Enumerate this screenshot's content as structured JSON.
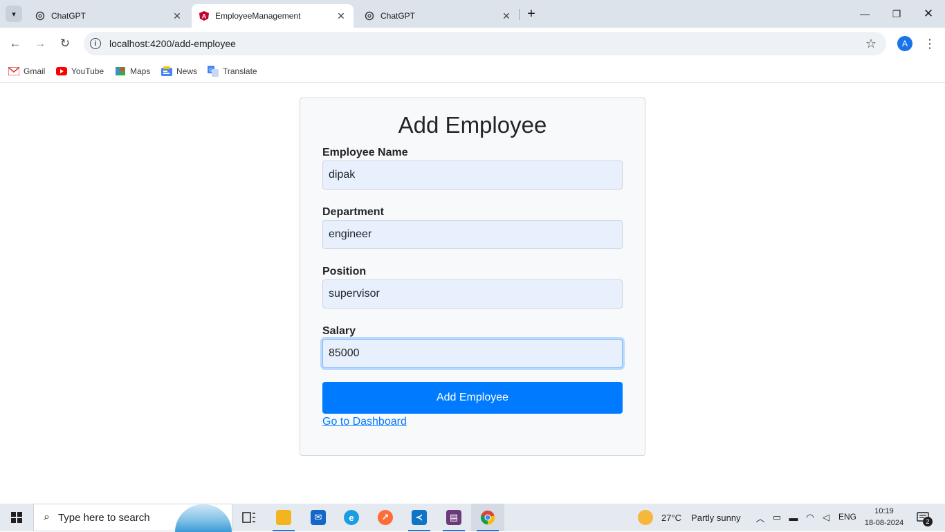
{
  "browser": {
    "tabs": [
      {
        "title": "ChatGPT",
        "active": false
      },
      {
        "title": "EmployeeManagement",
        "active": true
      },
      {
        "title": "ChatGPT",
        "active": false
      }
    ],
    "url": "localhost:4200/add-employee",
    "profile_initial": "A",
    "bookmarks": [
      "Gmail",
      "YouTube",
      "Maps",
      "News",
      "Translate"
    ]
  },
  "form": {
    "title": "Add Employee",
    "fields": [
      {
        "label": "Employee Name",
        "value": "dipak"
      },
      {
        "label": "Department",
        "value": "engineer"
      },
      {
        "label": "Position",
        "value": "supervisor"
      },
      {
        "label": "Salary",
        "value": "85000"
      }
    ],
    "submit_label": "Add Employee",
    "dashboard_link": "Go to Dashboard"
  },
  "taskbar": {
    "search_placeholder": "Type here to search",
    "weather_temp": "27°C",
    "weather_desc": "Partly sunny",
    "language": "ENG",
    "time": "10:19",
    "date": "18-08-2024",
    "notification_count": "2"
  },
  "colors": {
    "accent": "#007bff",
    "input_fill": "#e8f0fe",
    "card_bg": "#f8f9fa"
  }
}
